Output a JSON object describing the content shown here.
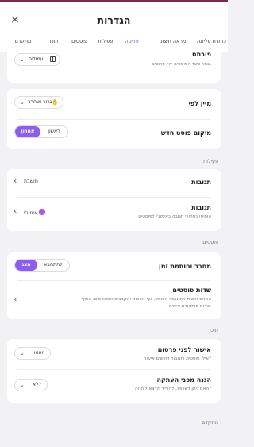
{
  "header": {
    "title": "הגדרות",
    "close_symbol": "×",
    "tabs": [
      {
        "label": "כותרת עליונה",
        "active": false
      },
      {
        "label": "מראה חיצוני",
        "active": false
      },
      {
        "label": "פריסה",
        "active": true
      },
      {
        "label": "פעילות",
        "active": false
      },
      {
        "label": "פוסטים",
        "active": false
      },
      {
        "label": "תוכן",
        "active": false
      },
      {
        "label": "מתקדם",
        "active": false
      }
    ]
  },
  "format": {
    "label": "פורמט",
    "description": "בחר כיצד הפוסטים יהיו פרוסים.",
    "value": "עמודים"
  },
  "sort": {
    "label": "מיין לפי",
    "value": "גרור ושחרר"
  },
  "new_post_position": {
    "label": "מיקום פוסט חדש",
    "options": [
      "ראשון",
      "אחרון"
    ],
    "selected": "אחרון"
  },
  "activity": {
    "section_title": "פעילות",
    "reactions": {
      "label": "תגובות",
      "value": "מושבת"
    },
    "comments": {
      "label": "תגובות",
      "description": "הוסיפו כפתורי תגובה באימוג'י לפוסטים",
      "value": "אימוג'י"
    }
  },
  "posts": {
    "section_title": "פוסטים",
    "author_time": {
      "label": "מחבר וחותמת זמן",
      "options": [
        "להתחבא",
        "הצג"
      ],
      "selected": "הצג"
    },
    "post_fields": {
      "label": "שדות פוסטים",
      "description_line1": "התאם אישית את נושא הפוסט, גוף הפוסט והקבצים המצורפים. הוסף",
      "description_line2": "שדות מותאמים אישית."
    }
  },
  "content": {
    "section_title": "תוכן",
    "approval": {
      "label": "אישור לפני פרסום",
      "description": "אילו פוסטים ותגובות דורשים אישור?",
      "value": "אוטו'"
    },
    "copy_protection": {
      "label": "הגנה מפני העתקה",
      "description": "האם ניתן לשכפל, להוריד ולייצא לוח זה?",
      "value": "ללא"
    }
  },
  "advanced": {
    "section_title": "מתקדם"
  },
  "colors": {
    "accent": "#8b5cf6",
    "background": "#f2f2f5",
    "card": "#ffffff",
    "topline": "#7a2a4e"
  },
  "icons": {
    "close": "close-icon",
    "format": "columns-icon",
    "sort": "hand-drag-icon",
    "dropdown": "chevron-down-icon",
    "nav": "chevron-left-icon",
    "emoji": "smiley-icon"
  }
}
